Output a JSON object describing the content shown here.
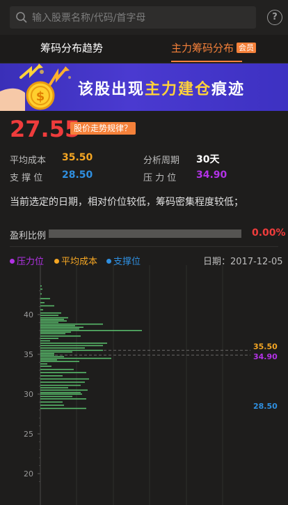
{
  "search": {
    "placeholder": "输入股票名称/代码/首字母"
  },
  "help": {
    "label": "?"
  },
  "tabs": [
    {
      "label": "筹码分布趋势"
    },
    {
      "label": "主力筹码分布",
      "badge": "会员"
    }
  ],
  "banner": {
    "text_a": "该股出现",
    "text_b": "主力建仓",
    "text_c": "痕迹"
  },
  "price": {
    "value": "27.55",
    "tag": "股价走势规律？"
  },
  "stats": {
    "avg_cost_label": "平均成本",
    "avg_cost": "35.50",
    "period_label": "分析周期",
    "period": "30天",
    "support_label": "支 撑 位",
    "support": "28.50",
    "pressure_label": "压 力 位",
    "pressure": "34.90"
  },
  "desc": "当前选定的日期，相对价位较低，筹码密集程度较低；",
  "profit": {
    "label": "盈利比例",
    "value": "0.00%",
    "ratio": 0
  },
  "legend": [
    {
      "label": "压力位",
      "color": "#b232e6"
    },
    {
      "label": "平均成本",
      "color": "#f5a623"
    },
    {
      "label": "支撑位",
      "color": "#2f8fe0"
    }
  ],
  "date": "日期：2017-12-05",
  "colors": {
    "up": "#ef3c3c",
    "accent": "#f5813a",
    "avg": "#f5a623",
    "support": "#2f8fe0",
    "pressure": "#b232e6",
    "bars": "#58b96a"
  },
  "chart_data": {
    "type": "bar",
    "orientation": "horizontal",
    "ylim": [
      18,
      44
    ],
    "y_ticks": [
      20,
      25,
      30,
      35,
      40
    ],
    "annotations": [
      {
        "label": "35.50",
        "y": 35.5,
        "color": "#f5a623"
      },
      {
        "label": "34.90",
        "y": 34.9,
        "color": "#b232e6"
      },
      {
        "label": "28.50",
        "y": 28.5,
        "color": "#2f8fe0"
      }
    ],
    "series": [
      {
        "x": [
          43.6,
          43.2,
          42.6,
          42.0,
          41.5,
          41.1,
          40.6,
          40.2,
          39.9,
          39.6,
          39.4,
          39.2,
          39.0,
          38.8,
          38.6,
          38.4,
          38.2,
          38.0,
          37.8,
          37.6,
          37.3,
          37.0,
          36.7,
          36.4,
          36.1,
          35.8,
          35.5,
          35.3,
          35.1,
          34.9,
          34.7,
          34.5,
          34.3,
          34.1,
          33.8,
          33.5,
          33.1,
          32.7,
          32.3,
          31.9,
          31.5,
          31.1,
          30.8,
          30.5,
          30.2,
          30.0,
          29.7,
          29.4,
          29.0,
          28.6,
          28.2
        ],
        "values": [
          2,
          3,
          2,
          14,
          6,
          20,
          4,
          30,
          26,
          40,
          34,
          38,
          26,
          90,
          50,
          62,
          56,
          146,
          44,
          36,
          58,
          26,
          14,
          96,
          90,
          64,
          90,
          46,
          20,
          20,
          34,
          102,
          24,
          56,
          10,
          16,
          48,
          66,
          32,
          70,
          64,
          58,
          40,
          68,
          58,
          60,
          46,
          66,
          32,
          34,
          66
        ]
      }
    ]
  }
}
